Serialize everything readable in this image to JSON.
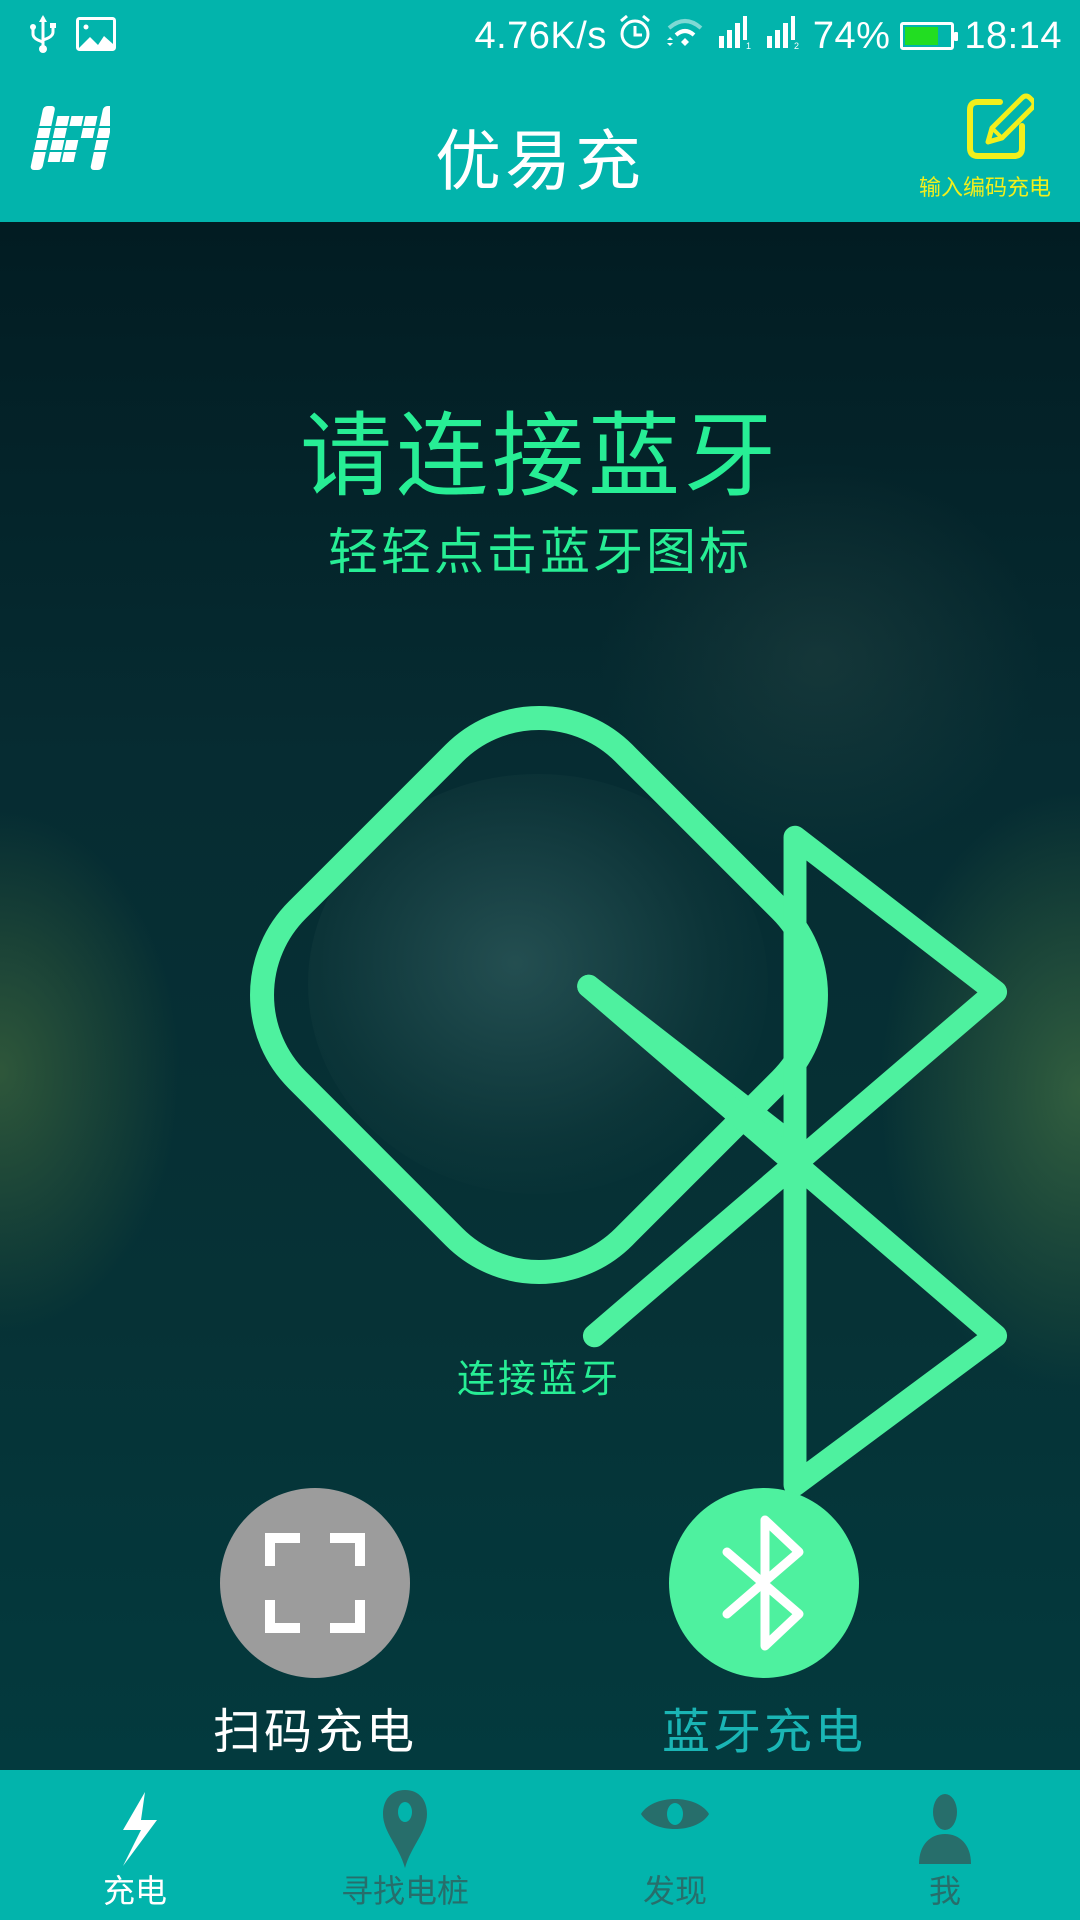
{
  "status_bar": {
    "left_icons": [
      "usb-icon",
      "image-icon"
    ],
    "network_speed": "4.76K/s",
    "icons": [
      "alarm-icon",
      "wifi-icon",
      "signal-sim1-icon",
      "signal-sim2-icon"
    ],
    "battery_percent_text": "74%",
    "battery_level": 0.74,
    "battery_color": "#22dd22",
    "time": "18:14"
  },
  "header": {
    "logo": "app-logo-icon",
    "title": "优易充",
    "code_charge": {
      "icon": "edit-pencil-icon",
      "label": "输入编码充电",
      "color": "#f2ef1c"
    }
  },
  "main": {
    "title": "请连接蓝牙",
    "subtitle": "轻轻点击蓝牙图标",
    "bluetooth_button": {
      "icon": "bluetooth-icon",
      "label": "连接蓝牙"
    },
    "accent_color": "#4ef19f"
  },
  "actions": [
    {
      "id": "scan",
      "icon": "scan-frame-icon",
      "label": "扫码充电",
      "circle_color": "#9c9c9c",
      "label_color": "#ffffff",
      "selected": false
    },
    {
      "id": "bluetooth",
      "icon": "bluetooth-icon",
      "label": "蓝牙充电",
      "circle_color": "#4ef19f",
      "label_color": "#1ab5b5",
      "selected": true
    }
  ],
  "bottom_nav": {
    "active_index": 0,
    "items": [
      {
        "icon": "lightning-icon",
        "label": "充电"
      },
      {
        "icon": "map-pin-icon",
        "label": "寻找电桩"
      },
      {
        "icon": "eye-icon",
        "label": "发现"
      },
      {
        "icon": "person-icon",
        "label": "我"
      }
    ]
  }
}
